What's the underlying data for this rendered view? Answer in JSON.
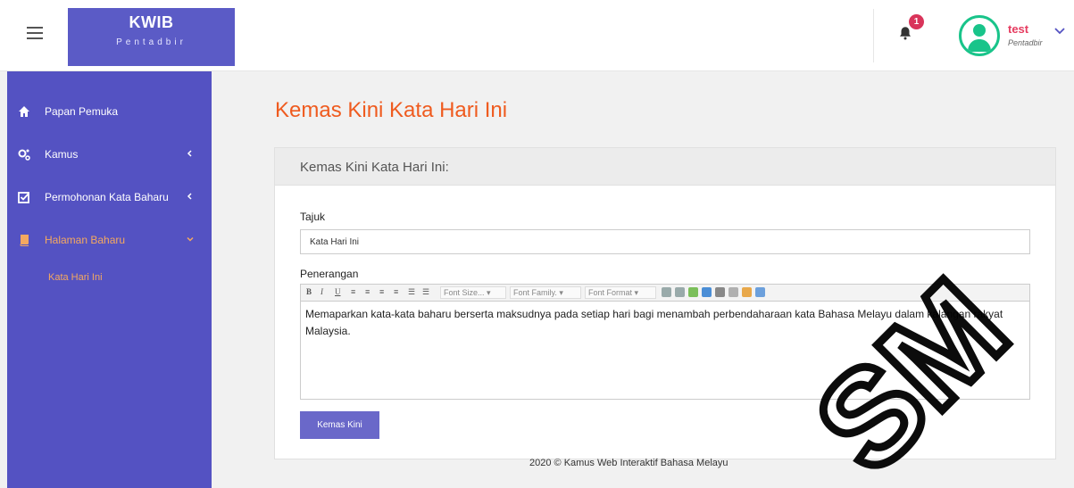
{
  "header": {
    "brand_title": "KWIB",
    "brand_subtitle": "Pentadbir",
    "notification_count": "1",
    "user_name": "test",
    "user_role": "Pentadbir"
  },
  "sidebar": {
    "items": [
      {
        "label": "Papan Pemuka",
        "icon": "home-icon"
      },
      {
        "label": "Kamus",
        "icon": "cogs-icon"
      },
      {
        "label": "Permohonan Kata Baharu",
        "icon": "check-square-icon"
      },
      {
        "label": "Halaman Baharu",
        "icon": "book-icon"
      }
    ],
    "sub_item": "Kata Hari Ini"
  },
  "main": {
    "page_title": "Kemas Kini Kata Hari Ini",
    "panel_title": "Kemas Kini Kata Hari Ini:",
    "field_title_label": "Tajuk",
    "field_title_value": "Kata Hari Ini",
    "field_desc_label": "Penerangan",
    "toolbar": {
      "bold": "B",
      "italic": "I",
      "underline": "U",
      "font_size": "Font Size...",
      "font_family": "Font Family.",
      "font_format": "Font Format"
    },
    "description": "Memaparkan kata-kata baharu berserta maksudnya pada setiap hari bagi menambah perbendaharaan kata Bahasa Melayu dalam kalangan rakyat Malaysia.",
    "submit_label": "Kemas Kini"
  },
  "footer": "2020 © Kamus Web Interaktif Bahasa Melayu",
  "watermark": "SM",
  "colors": {
    "sidebar": "#5452c2",
    "accent_orange": "#ef5b1f",
    "button": "#6a68c9",
    "badge": "#d9345a",
    "avatar_ring": "#19c48a"
  }
}
